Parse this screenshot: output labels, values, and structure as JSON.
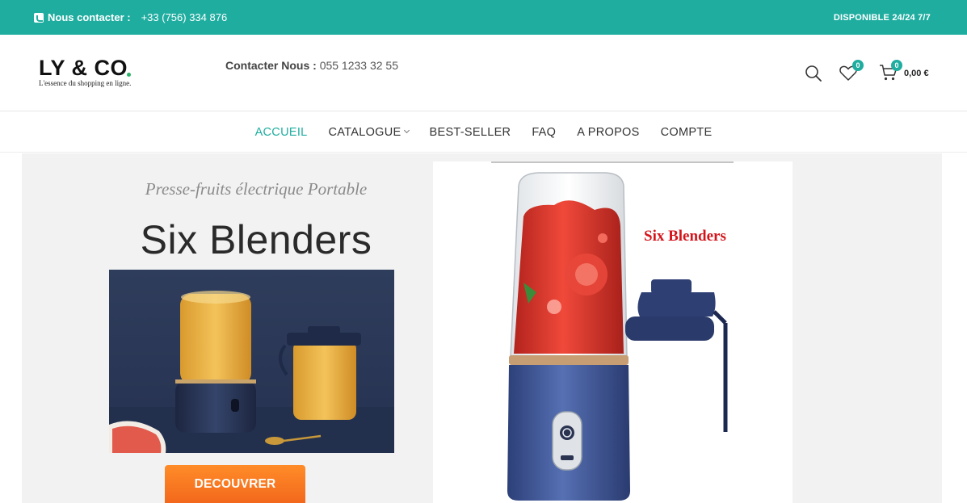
{
  "topbar": {
    "contact_label": "Nous contacter :",
    "phone": "+33 (756) 334 876",
    "availability": "DISPONIBLE 24/24 7/7"
  },
  "header": {
    "logo_text": "LY & CO",
    "logo_tagline": "L'essence du shopping en ligne.",
    "contact_label": "Contacter Nous :",
    "contact_phone": "055 1233 32 55",
    "wishlist_count": "0",
    "cart_count": "0",
    "cart_total": "0,00 €"
  },
  "nav": {
    "items": [
      {
        "label": "ACCUEIL"
      },
      {
        "label": "CATALOGUE"
      },
      {
        "label": "BEST-SELLER"
      },
      {
        "label": "FAQ"
      },
      {
        "label": "A PROPOS"
      },
      {
        "label": "COMPTE"
      }
    ]
  },
  "hero": {
    "subtitle": "Presse-fruits électrique Portable",
    "title": "Six Blenders",
    "cta_label": "DECOUVRER",
    "product_image_label": "Six Blenders"
  },
  "colors": {
    "accent": "#1fada0",
    "cta": "#f3681c",
    "product_label": "#d4141b"
  }
}
